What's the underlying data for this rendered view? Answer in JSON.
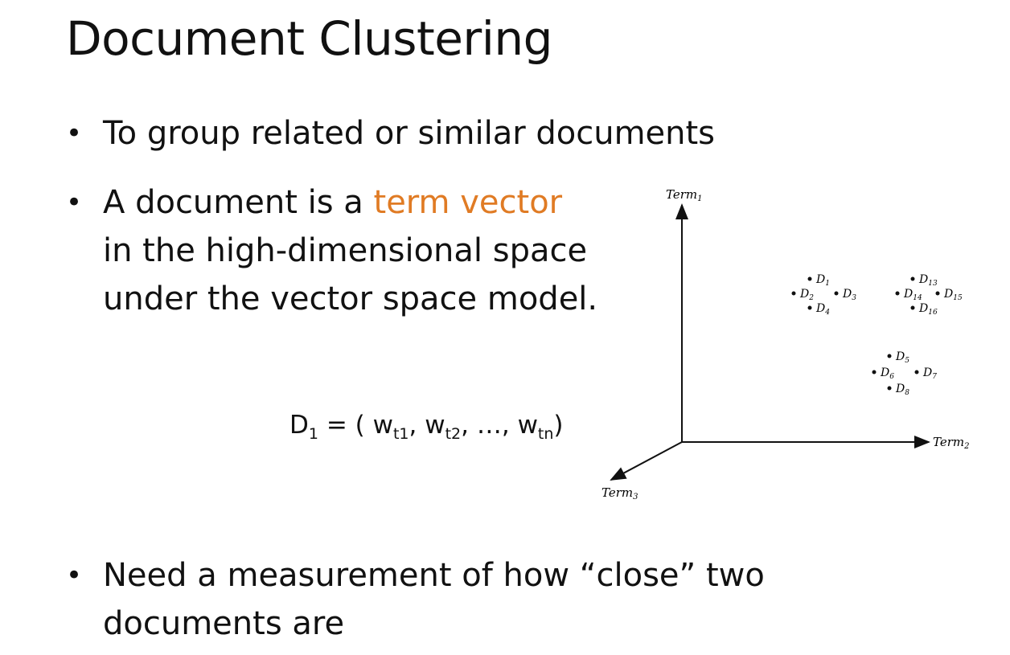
{
  "slide": {
    "title": "Document Clustering",
    "bullets": [
      {
        "text": "To group related or similar documents"
      },
      {
        "lines": [
          {
            "before": "A document is a ",
            "highlight": "term vector",
            "after": ""
          },
          {
            "text": "in the high-dimensional space"
          },
          {
            "text": "under the vector space model."
          }
        ]
      },
      {
        "lines": [
          {
            "text": "Need a measurement of how “close” two"
          },
          {
            "text": "documents are"
          }
        ]
      }
    ],
    "bullet_glyph": "•",
    "formula": {
      "lhs": "D",
      "lhs_sub": "1",
      "equals": " = ( ",
      "terms": [
        {
          "base": "w",
          "sub": "t1",
          "sep": ", "
        },
        {
          "base": "w",
          "sub": "t2",
          "sep": ", …, "
        },
        {
          "base": "w",
          "sub": "tn",
          "sep": ")"
        }
      ]
    },
    "accent_color": "#e07b24"
  },
  "diagram": {
    "axes": {
      "y_label": "Term",
      "y_sub": "1",
      "x_label": "Term",
      "x_sub": "2",
      "z_label": "Term",
      "z_sub": "3"
    },
    "documents": [
      {
        "label": "D",
        "sub": "1"
      },
      {
        "label": "D",
        "sub": "2"
      },
      {
        "label": "D",
        "sub": "3"
      },
      {
        "label": "D",
        "sub": "4"
      },
      {
        "label": "D",
        "sub": "5"
      },
      {
        "label": "D",
        "sub": "6"
      },
      {
        "label": "D",
        "sub": "7"
      },
      {
        "label": "D",
        "sub": "8"
      },
      {
        "label": "D",
        "sub": "13"
      },
      {
        "label": "D",
        "sub": "14"
      },
      {
        "label": "D",
        "sub": "15"
      },
      {
        "label": "D",
        "sub": "16"
      }
    ]
  }
}
